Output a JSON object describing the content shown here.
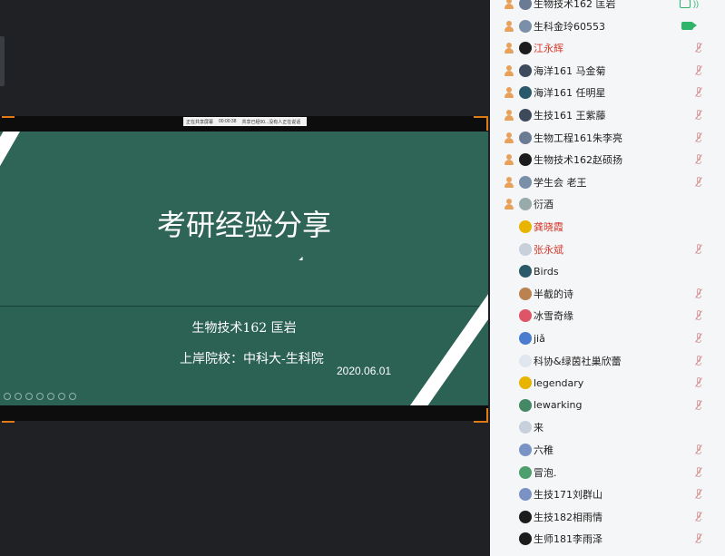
{
  "share_bar": {
    "items": [
      "正在共享屏幕",
      "00:00:38",
      "共享已经00...没有人正在说话"
    ]
  },
  "slide": {
    "title": "考研经验分享",
    "presenter": "生物技术162 匡岩",
    "school": "上岸院校：中科大-生科院",
    "date": "2020.06.01"
  },
  "members": [
    {
      "name": "生物技术162 匡岩",
      "status": "share-audio",
      "highlight": false
    },
    {
      "name": "生科金玲60553",
      "status": "camera",
      "highlight": false
    },
    {
      "name": "江永辉",
      "status": "muted",
      "highlight": true
    },
    {
      "name": "海洋161 马金菊",
      "status": "muted",
      "highlight": false
    },
    {
      "name": "海洋161 任明星",
      "status": "muted",
      "highlight": false
    },
    {
      "name": "生技161 王紫藤",
      "status": "muted",
      "highlight": false
    },
    {
      "name": "生物工程161朱李亮",
      "status": "muted",
      "highlight": false
    },
    {
      "name": "生物技术162赵硕扬",
      "status": "muted",
      "highlight": false
    },
    {
      "name": "学生会 老王",
      "status": "muted",
      "highlight": false
    },
    {
      "name": "衍酒",
      "status": "none",
      "highlight": false
    },
    {
      "name": "龚晓霞",
      "status": "none",
      "highlight": true
    },
    {
      "name": "张永斌",
      "status": "muted",
      "highlight": true
    },
    {
      "name": "Birds",
      "status": "none",
      "highlight": false
    },
    {
      "name": "半截的诗",
      "status": "muted",
      "highlight": false
    },
    {
      "name": "冰雪奇缘",
      "status": "muted",
      "highlight": false
    },
    {
      "name": "jiǎ",
      "status": "muted",
      "highlight": false
    },
    {
      "name": "科协&绿茵社巢欣蕾",
      "status": "muted",
      "highlight": false
    },
    {
      "name": "legendary",
      "status": "muted",
      "highlight": false
    },
    {
      "name": "lewarking",
      "status": "muted",
      "highlight": false
    },
    {
      "name": "来",
      "status": "none",
      "highlight": false
    },
    {
      "name": "六稚",
      "status": "muted",
      "highlight": false
    },
    {
      "name": "冒泡.",
      "status": "muted",
      "highlight": false
    },
    {
      "name": "生技171刘群山",
      "status": "muted",
      "highlight": false
    },
    {
      "name": "生技182相雨情",
      "status": "muted",
      "highlight": false
    },
    {
      "name": "生师181李雨泽",
      "status": "muted",
      "highlight": false
    }
  ],
  "colors": {
    "slide_bg": "#2f6557",
    "accent_orange": "#e07a17",
    "mic_muted": "#d98c8c",
    "active_green": "#2fb56a",
    "highlight_name": "#d33a2c"
  }
}
